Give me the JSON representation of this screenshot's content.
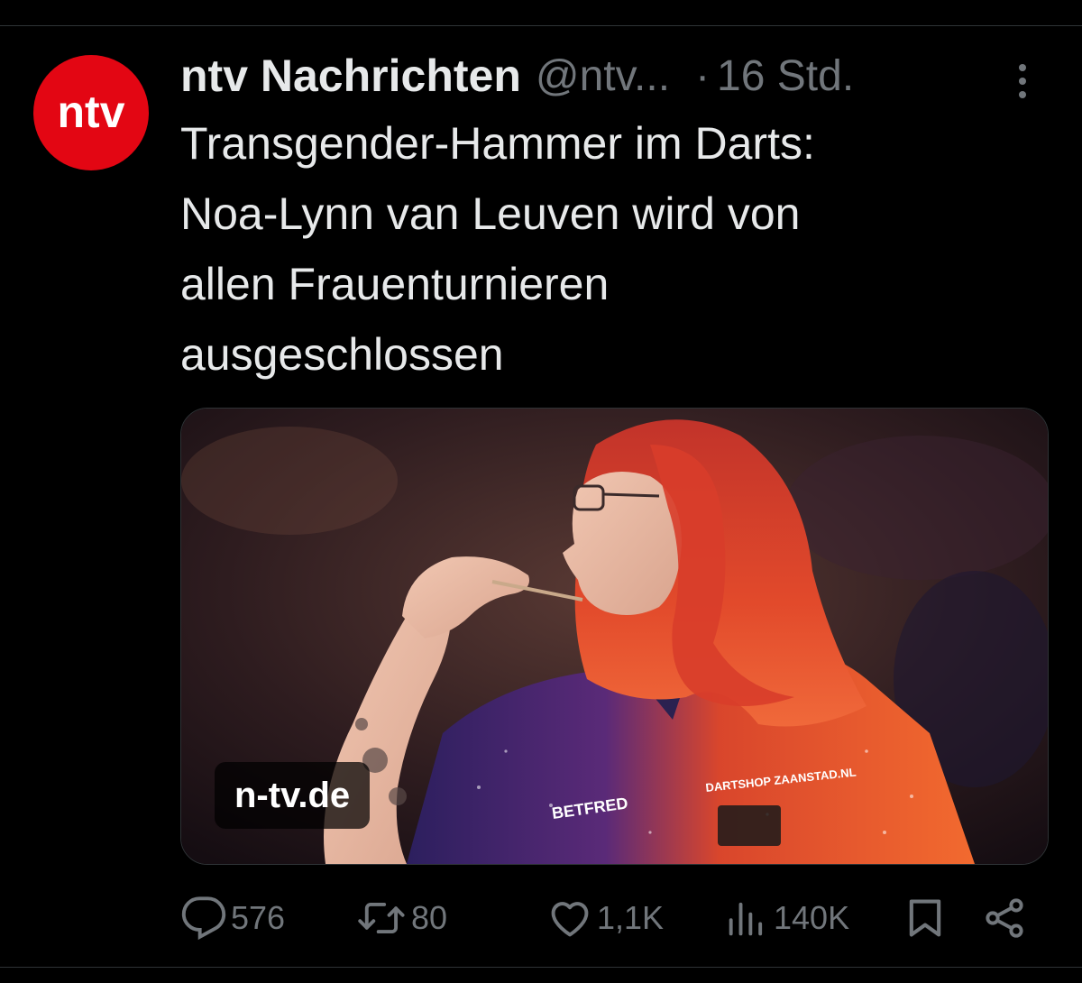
{
  "account": {
    "avatar_text": "ntv",
    "avatar_color": "#e30613",
    "name": "ntv Nachrichten",
    "handle": "@ntv...",
    "separator": "·",
    "time": "16 Std."
  },
  "tweet": {
    "text": "Transgender-Hammer im Darts:\nNoa-Lynn van Leuven wird von\nallen Frauenturnieren\nausgeschlossen",
    "media": {
      "source_label": "n-tv.de",
      "jersey_sponsor_1": "BETFRED",
      "jersey_sponsor_2": "DARTSHOP ZAANSTAD.NL"
    }
  },
  "actions": {
    "replies": "576",
    "reposts": "80",
    "likes": "1,1K",
    "views": "140K"
  },
  "icons": {
    "more": "more-vertical-icon",
    "reply": "reply-icon",
    "repost": "repost-icon",
    "like": "heart-icon",
    "views": "views-icon",
    "bookmark": "bookmark-icon",
    "share": "share-icon"
  },
  "colors": {
    "background": "#000000",
    "text": "#e7e9ea",
    "secondary": "#71767b",
    "divider": "#2f3336"
  }
}
